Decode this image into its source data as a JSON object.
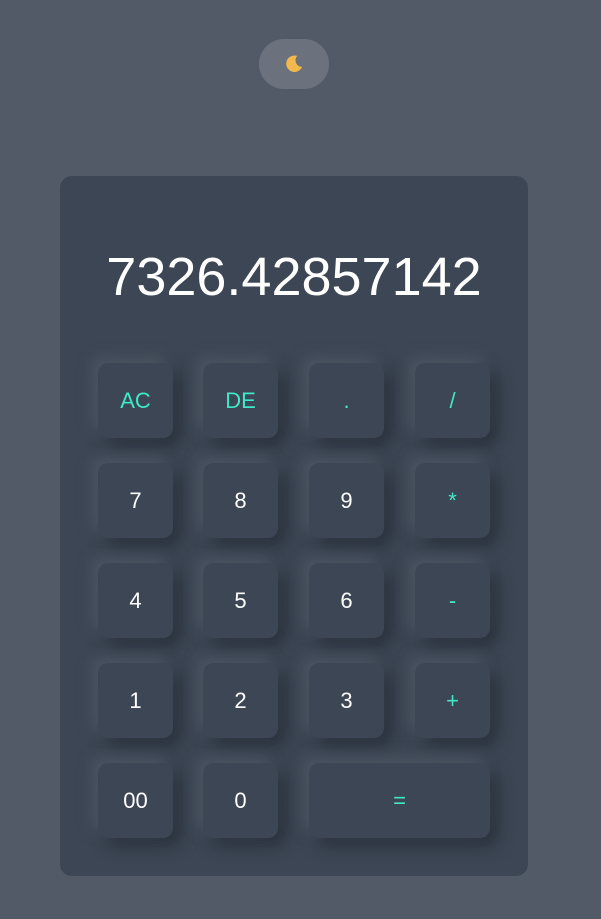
{
  "theme_toggle": {
    "icon": "moon-icon"
  },
  "display": {
    "value": "7326.42857142"
  },
  "colors": {
    "background": "#525a68",
    "panel": "#3d4654",
    "accent": "#3fe8c8",
    "text": "#ffffff",
    "toggle": "#6c727d"
  },
  "keys": {
    "ac": "AC",
    "de": "DE",
    "dot": ".",
    "divide": "/",
    "seven": "7",
    "eight": "8",
    "nine": "9",
    "multiply": "*",
    "four": "4",
    "five": "5",
    "six": "6",
    "minus": "-",
    "one": "1",
    "two": "2",
    "three": "3",
    "plus": "+",
    "double_zero": "00",
    "zero": "0",
    "equals": "="
  }
}
